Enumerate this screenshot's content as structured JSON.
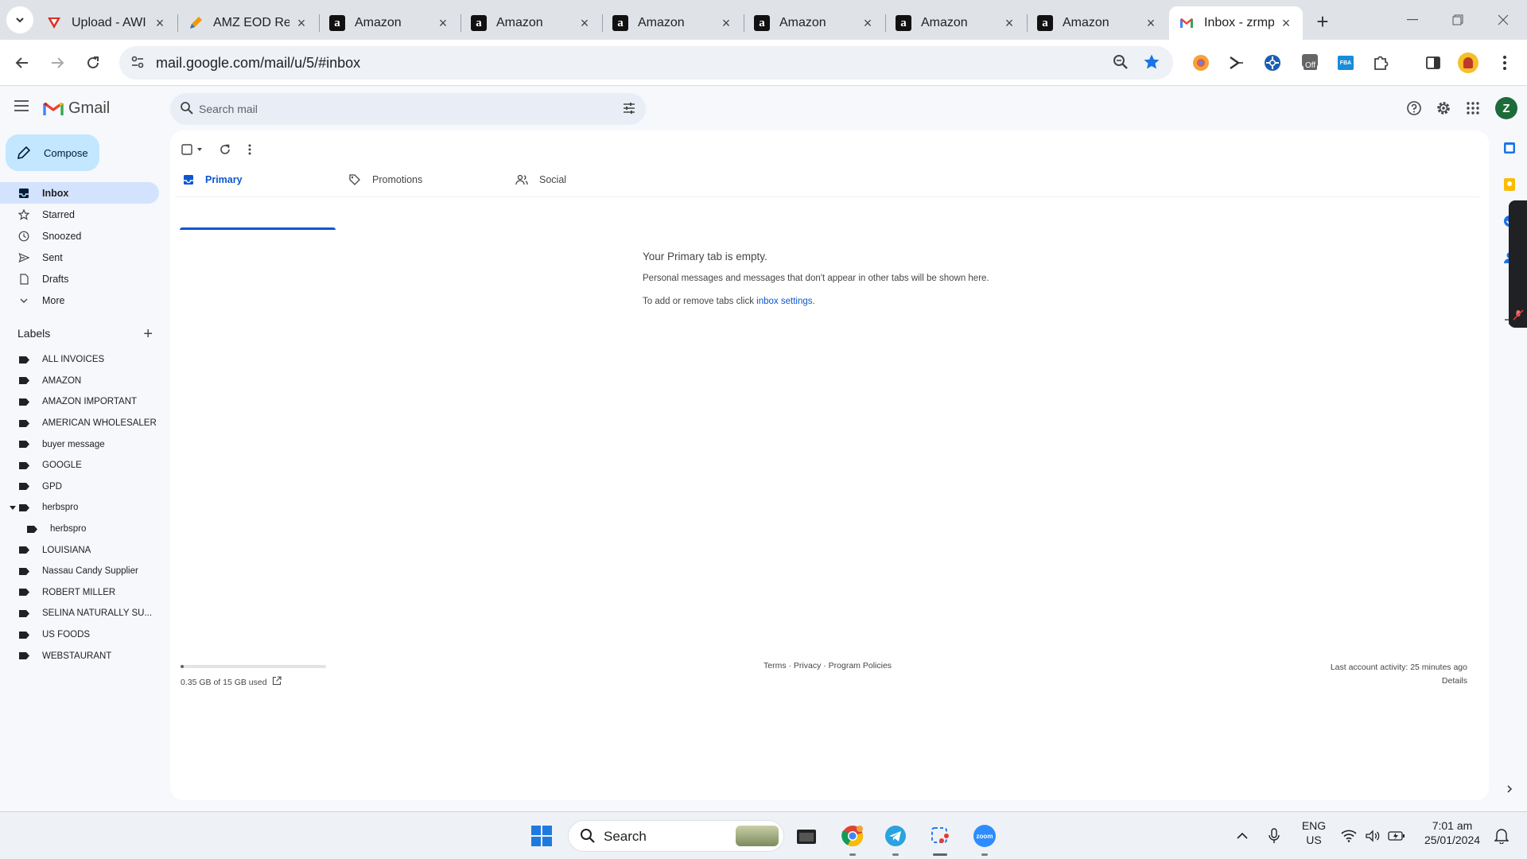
{
  "browser": {
    "tabs": [
      {
        "title": "Upload - AWI",
        "favicon": "red-triangle-icon",
        "active": false
      },
      {
        "title": "AMZ EOD Re",
        "favicon": "orange-pen-icon",
        "active": false
      },
      {
        "title": "Amazon",
        "favicon": "amazon-icon",
        "active": false
      },
      {
        "title": "Amazon",
        "favicon": "amazon-icon",
        "active": false
      },
      {
        "title": "Amazon",
        "favicon": "amazon-icon",
        "active": false
      },
      {
        "title": "Amazon",
        "favicon": "amazon-icon",
        "active": false
      },
      {
        "title": "Amazon",
        "favicon": "amazon-icon",
        "active": false
      },
      {
        "title": "Amazon",
        "favicon": "amazon-icon",
        "active": false
      },
      {
        "title": "Inbox - zrmp",
        "favicon": "gmail-icon",
        "active": true
      }
    ],
    "url": "mail.google.com/mail/u/5/#inbox",
    "extension_badge": "Off",
    "fba_badge": "FBA"
  },
  "gmail": {
    "brand": "Gmail",
    "search_placeholder": "Search mail",
    "avatar_letter": "Z",
    "compose_label": "Compose",
    "nav": [
      {
        "label": "Inbox",
        "icon": "inbox-icon",
        "active": true
      },
      {
        "label": "Starred",
        "icon": "star-icon",
        "active": false
      },
      {
        "label": "Snoozed",
        "icon": "clock-icon",
        "active": false
      },
      {
        "label": "Sent",
        "icon": "send-icon",
        "active": false
      },
      {
        "label": "Drafts",
        "icon": "draft-icon",
        "active": false
      },
      {
        "label": "More",
        "icon": "chevron-down-icon",
        "active": false
      }
    ],
    "labels_heading": "Labels",
    "labels": [
      "ALL INVOICES",
      "AMAZON",
      "AMAZON IMPORTANT",
      "AMERICAN WHOLESALER",
      "buyer message",
      "GOOGLE",
      "GPD",
      "herbspro",
      "herbspro",
      "LOUISIANA",
      "Nassau Candy Supplier",
      "ROBERT MILLER",
      "SELINA NATURALLY SU...",
      "US FOODS",
      "WEBSTAURANT"
    ],
    "category_tabs": [
      {
        "label": "Primary",
        "icon": "inbox-tab-icon",
        "active": true
      },
      {
        "label": "Promotions",
        "icon": "tag-icon",
        "active": false
      },
      {
        "label": "Social",
        "icon": "people-icon",
        "active": false
      }
    ],
    "empty_state": {
      "title": "Your Primary tab is empty.",
      "line1": "Personal messages and messages that don't appear in other tabs will be shown here.",
      "line2_prefix": "To add or remove tabs click ",
      "line2_link": "inbox settings",
      "line2_suffix": "."
    },
    "storage": {
      "text": "0.35 GB of 15 GB used",
      "fraction": 0.023
    },
    "footer_links": "Terms · Privacy · Program Policies",
    "last_activity": "Last account activity: 25 minutes ago",
    "details_link": "Details"
  },
  "taskbar": {
    "search_label": "Search",
    "lang_line1": "ENG",
    "lang_line2": "US",
    "time": "7:01 am",
    "date": "25/01/2024"
  },
  "colors": {
    "accent": "#0b57d0",
    "compose_bg": "#c2e7ff",
    "active_nav": "#d3e3fd"
  }
}
